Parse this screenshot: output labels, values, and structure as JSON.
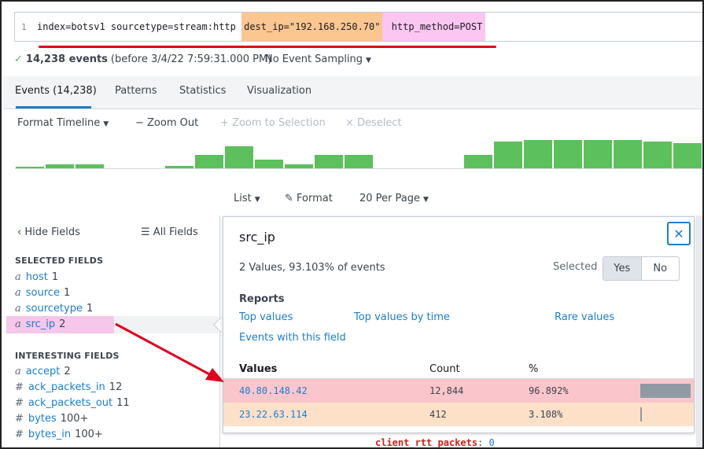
{
  "search": {
    "line_number": "1",
    "query_part1": "index=botsv1 sourcetype=stream:http ",
    "query_part2": "dest_ip=\"192.168.250.70\"",
    "query_part3": " http_method=POST"
  },
  "status": {
    "check": "✓",
    "events": "14,238 events",
    "before": "(before 3/4/22 7:59:31.000 PM)",
    "sampling": "No Event Sampling"
  },
  "tabs": [
    {
      "label": "Events (14,238)"
    },
    {
      "label": "Patterns"
    },
    {
      "label": "Statistics"
    },
    {
      "label": "Visualization"
    }
  ],
  "timeline": {
    "format": "Format Timeline",
    "zoom_out": "− Zoom Out",
    "zoom_selection": "+ Zoom to Selection",
    "deselect": "× Deselect",
    "bar_levels": [
      0.05,
      0.1,
      0.12,
      0,
      0,
      0.06,
      0.38,
      0.63,
      0.25,
      0.1,
      0.38,
      0.38,
      0,
      0,
      0,
      0.38,
      0.75,
      0.8,
      0.8,
      0.8,
      0.8,
      0.76,
      0.72
    ],
    "bar_color": "#5cc05c"
  },
  "list_controls": {
    "list": "List",
    "format": "Format",
    "per_page": "20 Per Page"
  },
  "fields_panel": {
    "hide_fields": "Hide Fields",
    "all_fields": "All Fields",
    "selected_heading": "SELECTED FIELDS",
    "interesting_heading": "INTERESTING FIELDS",
    "selected": [
      {
        "type": "a",
        "name": "host",
        "count": "1"
      },
      {
        "type": "a",
        "name": "source",
        "count": "1"
      },
      {
        "type": "a",
        "name": "sourcetype",
        "count": "1"
      },
      {
        "type": "a",
        "name": "src_ip",
        "count": "2"
      }
    ],
    "interesting": [
      {
        "type": "a",
        "name": "accept",
        "count": "2"
      },
      {
        "type": "#",
        "name": "ack_packets_in",
        "count": "12"
      },
      {
        "type": "#",
        "name": "ack_packets_out",
        "count": "11"
      },
      {
        "type": "#",
        "name": "bytes",
        "count": "100+"
      },
      {
        "type": "#",
        "name": "bytes_in",
        "count": "100+"
      }
    ]
  },
  "popover": {
    "title": "src_ip",
    "close": "✕",
    "summary": "2 Values, 93.103% of events",
    "selected_label": "Selected",
    "yes": "Yes",
    "no": "No",
    "reports_label": "Reports",
    "report_links": [
      "Top values",
      "Top values by time",
      "Rare values",
      "Events with this field"
    ],
    "columns": {
      "values": "Values",
      "count": "Count",
      "percent": "%"
    },
    "rows": [
      {
        "value": "40.80.148.42",
        "count": "12,844",
        "percent": "96.892%",
        "share": 0.96892
      },
      {
        "value": "23.22.63.114",
        "count": "412",
        "percent": "3.108%",
        "share": 0.03108
      }
    ]
  },
  "event_field": {
    "name": "client_rtt_packets",
    "sep": ":",
    "value": "0"
  },
  "colors": {
    "accent": "#1a7ed1",
    "highlight_orange": "#fbc690",
    "highlight_pink": "#fcc6f2",
    "annotation_red": "#e0001b"
  }
}
